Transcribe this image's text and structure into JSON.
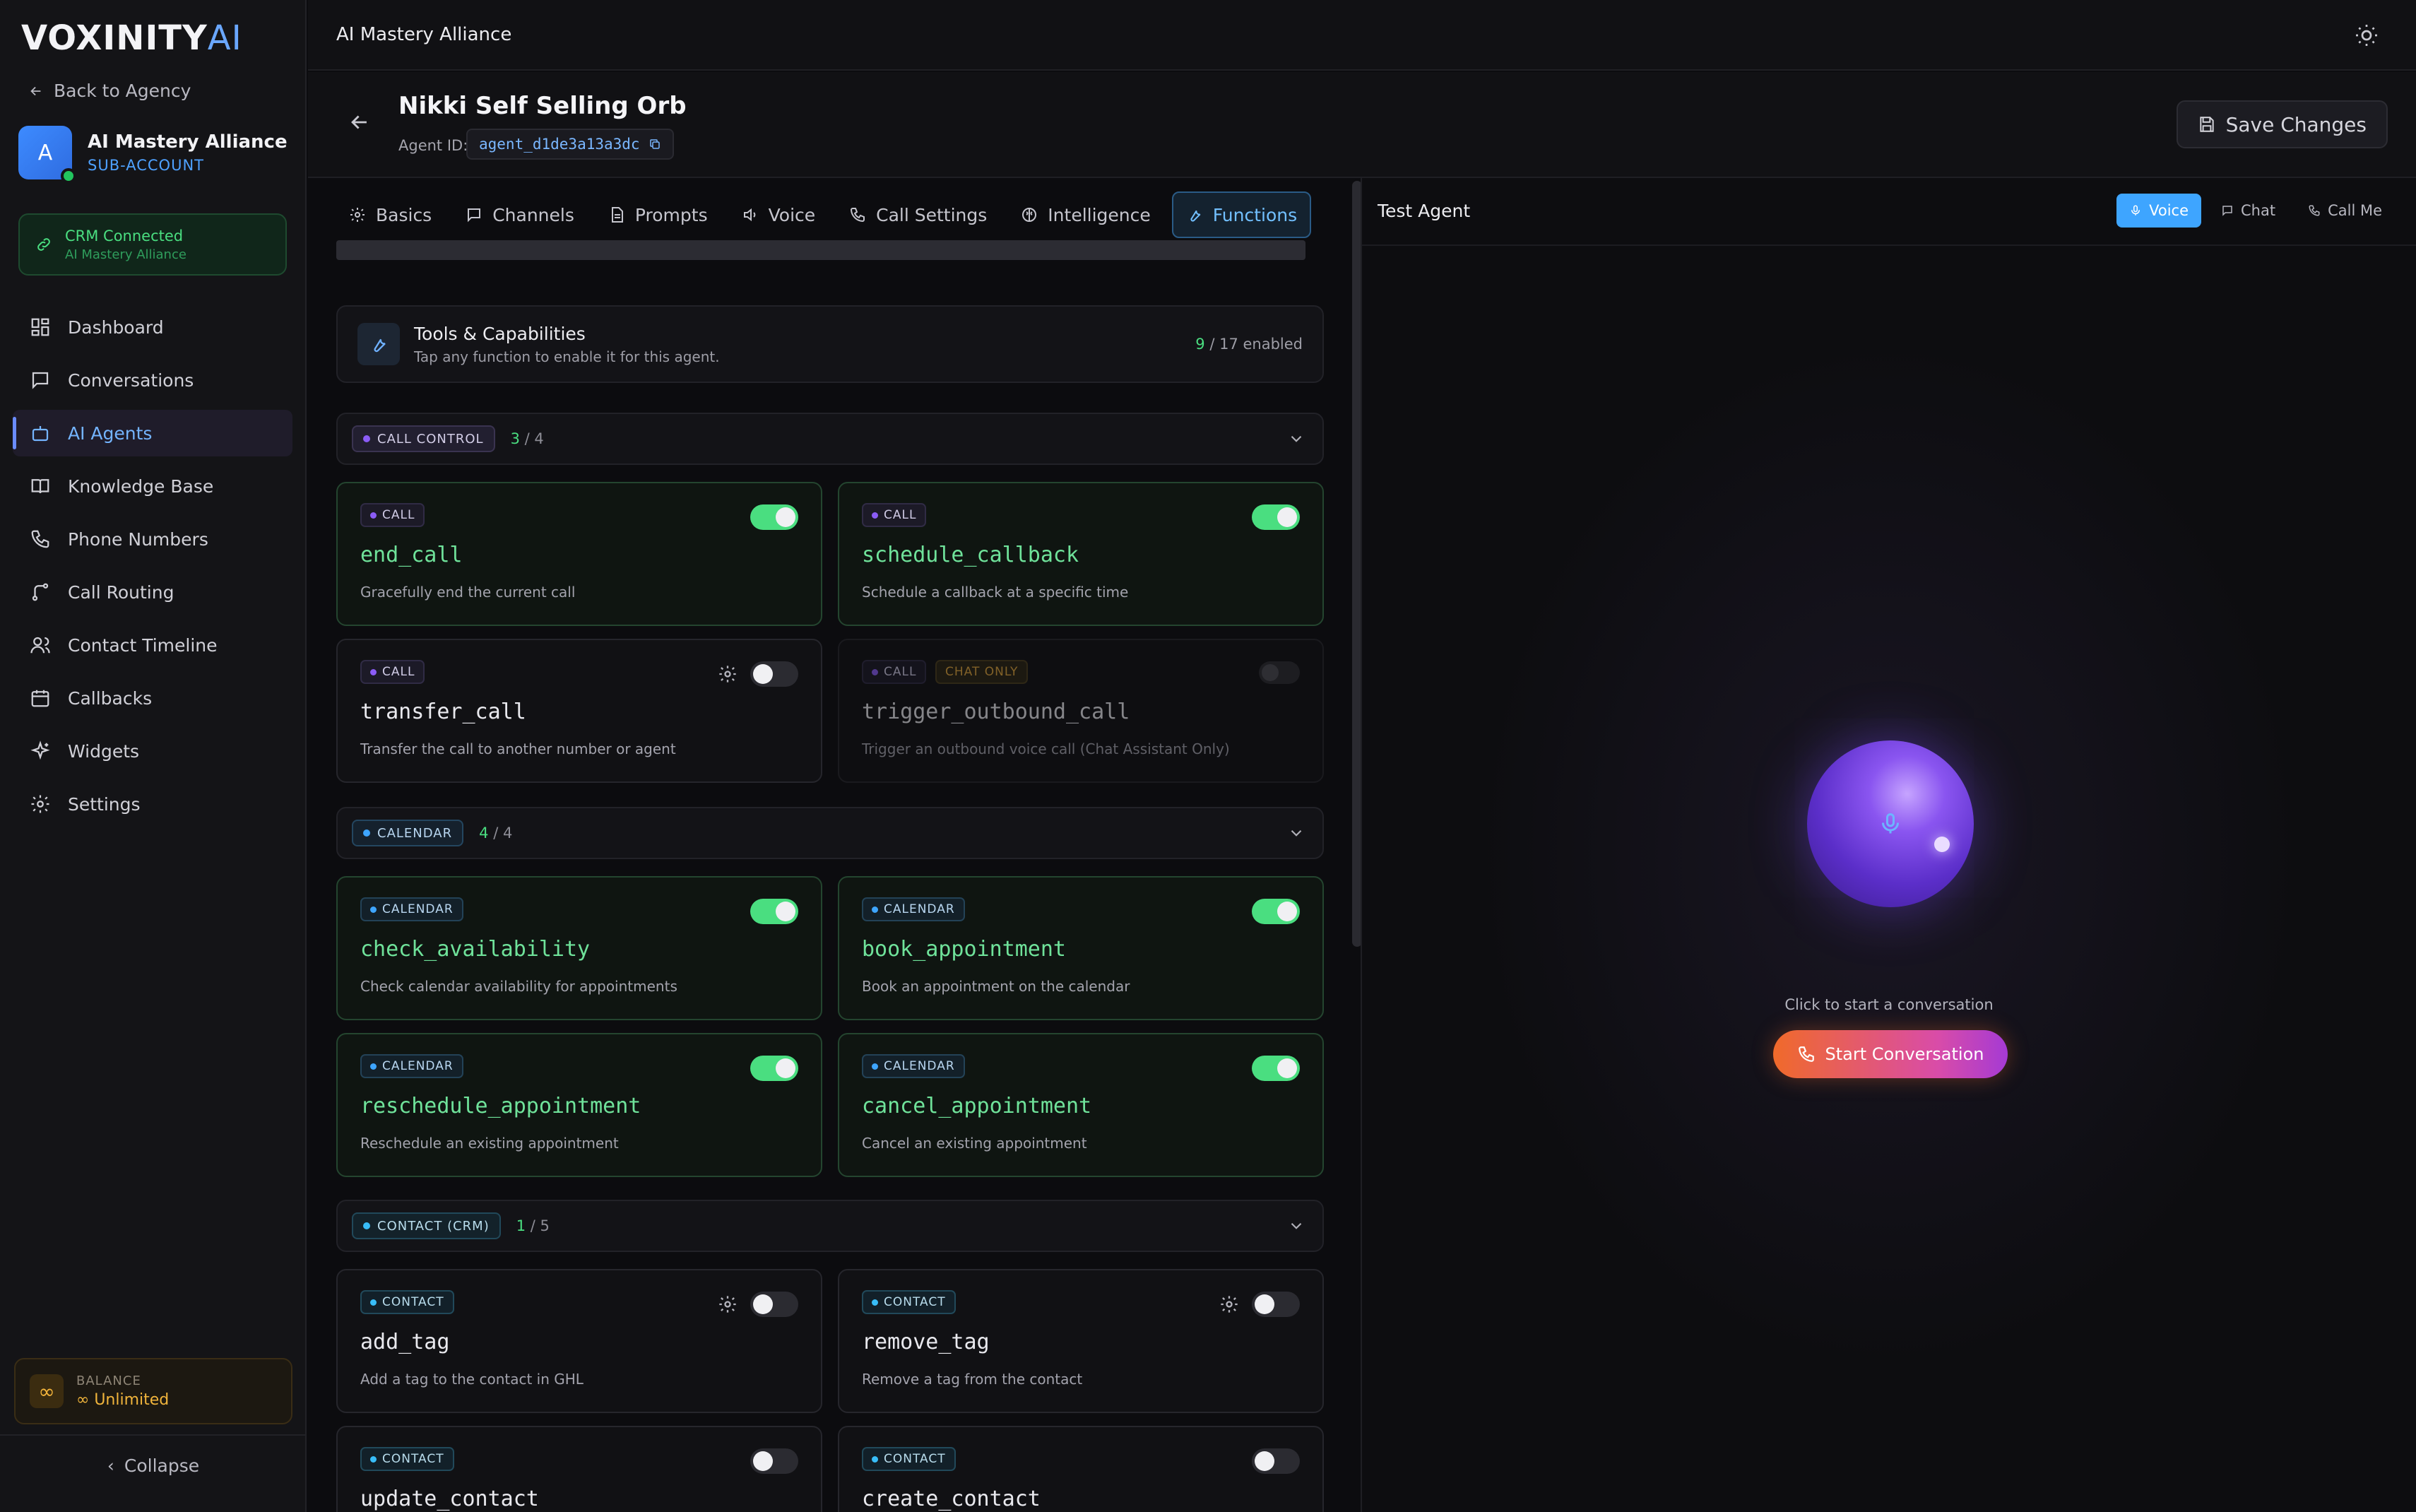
{
  "brand": {
    "logo_main": "VOXINITY",
    "logo_ai": "AI"
  },
  "sidebar": {
    "back_label": "Back to Agency",
    "account": {
      "initial": "A",
      "name": "AI Mastery Alliance",
      "type": "SUB-ACCOUNT"
    },
    "crm": {
      "status": "CRM Connected",
      "account": "AI Mastery Alliance"
    },
    "nav": [
      {
        "label": "Dashboard",
        "icon": "grid-icon"
      },
      {
        "label": "Conversations",
        "icon": "chat-icon"
      },
      {
        "label": "AI Agents",
        "icon": "robot-icon",
        "active": true
      },
      {
        "label": "Knowledge Base",
        "icon": "book-icon"
      },
      {
        "label": "Phone Numbers",
        "icon": "phone-icon"
      },
      {
        "label": "Call Routing",
        "icon": "routing-icon"
      },
      {
        "label": "Contact Timeline",
        "icon": "users-icon"
      },
      {
        "label": "Callbacks",
        "icon": "calendar-icon"
      },
      {
        "label": "Widgets",
        "icon": "sparkle-icon"
      },
      {
        "label": "Settings",
        "icon": "gear-icon"
      }
    ],
    "balance_label": "BALANCE",
    "balance_value": "Unlimited",
    "collapse_label": "Collapse"
  },
  "topbar": {
    "title": "AI Mastery Alliance"
  },
  "agent": {
    "name": "Nikki Self Selling Orb",
    "id_label": "Agent ID:",
    "id": "agent_d1de3a13a3dc",
    "save_label": "Save Changes"
  },
  "tabs": [
    "Basics",
    "Channels",
    "Prompts",
    "Voice",
    "Call Settings",
    "Intelligence",
    "Functions"
  ],
  "tools": {
    "title": "Tools & Capabilities",
    "subtitle": "Tap any function to enable it for this agent.",
    "enabled": "9",
    "total": "/ 17 enabled"
  },
  "sections": [
    {
      "label": "CALL CONTROL",
      "on": "3",
      "total": "/ 4"
    },
    {
      "label": "CALENDAR",
      "on": "4",
      "total": "/ 4"
    },
    {
      "label": "CONTACT (CRM)",
      "on": "1",
      "total": "/ 5"
    }
  ],
  "functions": [
    {
      "tag": "CALL",
      "name": "end_call",
      "desc": "Gracefully end the current call"
    },
    {
      "tag": "CALL",
      "name": "schedule_callback",
      "desc": "Schedule a callback at a specific time"
    },
    {
      "tag": "CALL",
      "name": "transfer_call",
      "desc": "Transfer the call to another number or agent"
    },
    {
      "tag": "CALL",
      "extra_tag": "CHAT ONLY",
      "name": "trigger_outbound_call",
      "desc": "Trigger an outbound voice call (Chat Assistant Only)"
    },
    {
      "tag": "CALENDAR",
      "name": "check_availability",
      "desc": "Check calendar availability for appointments"
    },
    {
      "tag": "CALENDAR",
      "name": "book_appointment",
      "desc": "Book an appointment on the calendar"
    },
    {
      "tag": "CALENDAR",
      "name": "reschedule_appointment",
      "desc": "Reschedule an existing appointment"
    },
    {
      "tag": "CALENDAR",
      "name": "cancel_appointment",
      "desc": "Cancel an existing appointment"
    },
    {
      "tag": "CONTACT",
      "name": "add_tag",
      "desc": "Add a tag to the contact in GHL"
    },
    {
      "tag": "CONTACT",
      "name": "remove_tag",
      "desc": "Remove a tag from the contact"
    },
    {
      "tag": "CONTACT",
      "name": "update_contact",
      "desc": ""
    },
    {
      "tag": "CONTACT",
      "name": "create_contact",
      "desc": ""
    }
  ],
  "test": {
    "title": "Test Agent",
    "modes": [
      "Voice",
      "Chat",
      "Call Me"
    ],
    "hint": "Click to start a conversation",
    "start_label": "Start Conversation"
  },
  "colors": {
    "accent": "#3ea5ff",
    "enabled": "#4ade80",
    "call_dot": "#8b5cf6",
    "calendar_dot": "#3ea5ff",
    "contact_dot": "#38bdf8"
  }
}
